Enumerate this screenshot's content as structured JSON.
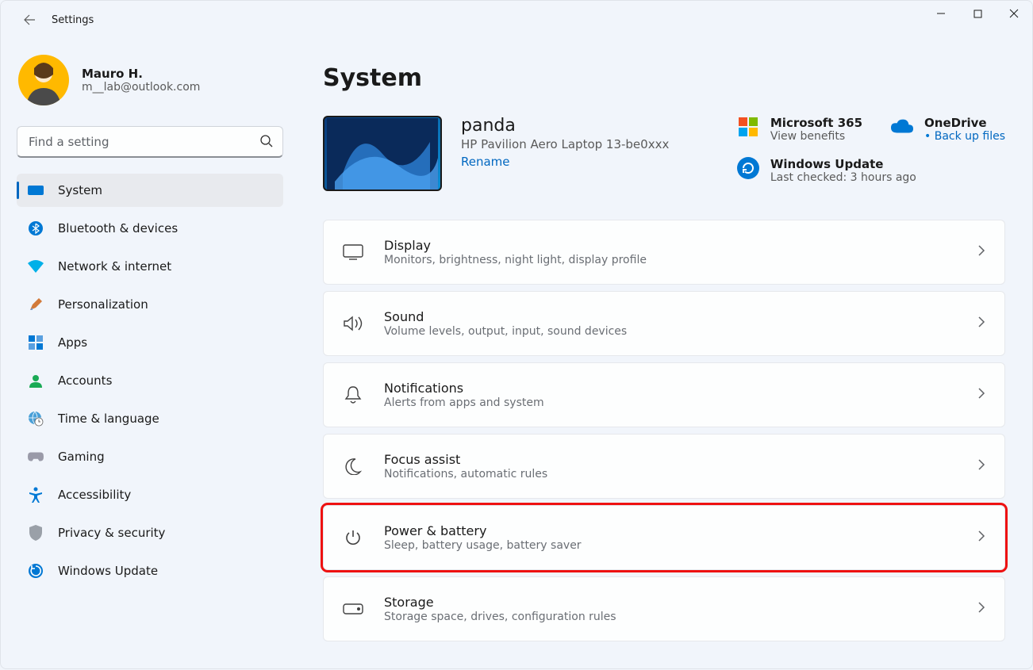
{
  "titlebar": {
    "title": "Settings"
  },
  "profile": {
    "name": "Mauro H.",
    "email": "m__lab@outlook.com"
  },
  "search": {
    "placeholder": "Find a setting"
  },
  "nav": {
    "items": [
      {
        "id": "system",
        "label": "System"
      },
      {
        "id": "bluetooth",
        "label": "Bluetooth & devices"
      },
      {
        "id": "network",
        "label": "Network & internet"
      },
      {
        "id": "personalization",
        "label": "Personalization"
      },
      {
        "id": "apps",
        "label": "Apps"
      },
      {
        "id": "accounts",
        "label": "Accounts"
      },
      {
        "id": "time",
        "label": "Time & language"
      },
      {
        "id": "gaming",
        "label": "Gaming"
      },
      {
        "id": "accessibility",
        "label": "Accessibility"
      },
      {
        "id": "privacy",
        "label": "Privacy & security"
      },
      {
        "id": "update",
        "label": "Windows Update"
      }
    ]
  },
  "main": {
    "title": "System",
    "device": {
      "name": "panda",
      "model": "HP Pavilion Aero Laptop 13-be0xxx",
      "rename": "Rename"
    },
    "cards": {
      "m365": {
        "title": "Microsoft 365",
        "sub": "View benefits"
      },
      "onedrive": {
        "title": "OneDrive",
        "sub": "Back up files"
      },
      "update": {
        "title": "Windows Update",
        "sub": "Last checked: 3 hours ago"
      }
    },
    "rows": [
      {
        "id": "display",
        "title": "Display",
        "sub": "Monitors, brightness, night light, display profile"
      },
      {
        "id": "sound",
        "title": "Sound",
        "sub": "Volume levels, output, input, sound devices"
      },
      {
        "id": "notifications",
        "title": "Notifications",
        "sub": "Alerts from apps and system"
      },
      {
        "id": "focus",
        "title": "Focus assist",
        "sub": "Notifications, automatic rules"
      },
      {
        "id": "power",
        "title": "Power & battery",
        "sub": "Sleep, battery usage, battery saver",
        "highlighted": true
      },
      {
        "id": "storage",
        "title": "Storage",
        "sub": "Storage space, drives, configuration rules"
      }
    ]
  }
}
